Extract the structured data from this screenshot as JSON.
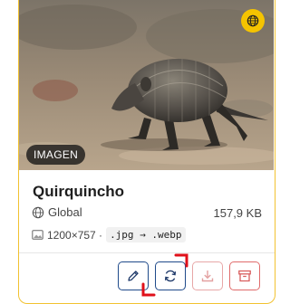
{
  "card": {
    "title": "Quirquincho",
    "badge": "IMAGEN",
    "scope": "Global",
    "file_size": "157,9 KB",
    "dimensions": "1200×757 ·",
    "conversion": ".jpg → .webp"
  },
  "icons": {
    "visibility": "globe-icon",
    "edit": "pencil-icon",
    "convert": "refresh-icon",
    "download": "download-icon",
    "archive": "archive-icon"
  },
  "colors": {
    "accent": "#f5c400",
    "primary_outline": "#1f4a8a",
    "danger": "#e06b6b",
    "highlight": "#e0101a"
  }
}
